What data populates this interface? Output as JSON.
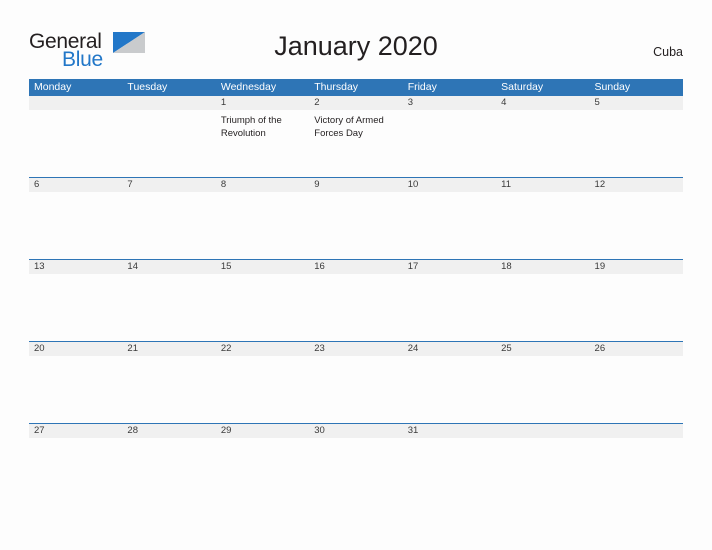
{
  "brand": {
    "name_part1": "General",
    "name_part2": "Blue",
    "flag_icon": "flag-triangle-icon",
    "color_primary": "#2277c8",
    "color_text": "#231f20"
  },
  "header": {
    "title": "January 2020",
    "country": "Cuba"
  },
  "calendar": {
    "header_bg": "#2e75b6",
    "date_band_bg": "#f0f0f0",
    "weekday_headers": [
      "Monday",
      "Tuesday",
      "Wednesday",
      "Thursday",
      "Friday",
      "Saturday",
      "Sunday"
    ],
    "weeks": [
      {
        "days": [
          {
            "date": "",
            "event": ""
          },
          {
            "date": "",
            "event": ""
          },
          {
            "date": "1",
            "event": "Triumph of the Revolution"
          },
          {
            "date": "2",
            "event": "Victory of Armed Forces Day"
          },
          {
            "date": "3",
            "event": ""
          },
          {
            "date": "4",
            "event": ""
          },
          {
            "date": "5",
            "event": ""
          }
        ]
      },
      {
        "days": [
          {
            "date": "6",
            "event": ""
          },
          {
            "date": "7",
            "event": ""
          },
          {
            "date": "8",
            "event": ""
          },
          {
            "date": "9",
            "event": ""
          },
          {
            "date": "10",
            "event": ""
          },
          {
            "date": "11",
            "event": ""
          },
          {
            "date": "12",
            "event": ""
          }
        ]
      },
      {
        "days": [
          {
            "date": "13",
            "event": ""
          },
          {
            "date": "14",
            "event": ""
          },
          {
            "date": "15",
            "event": ""
          },
          {
            "date": "16",
            "event": ""
          },
          {
            "date": "17",
            "event": ""
          },
          {
            "date": "18",
            "event": ""
          },
          {
            "date": "19",
            "event": ""
          }
        ]
      },
      {
        "days": [
          {
            "date": "20",
            "event": ""
          },
          {
            "date": "21",
            "event": ""
          },
          {
            "date": "22",
            "event": ""
          },
          {
            "date": "23",
            "event": ""
          },
          {
            "date": "24",
            "event": ""
          },
          {
            "date": "25",
            "event": ""
          },
          {
            "date": "26",
            "event": ""
          }
        ]
      },
      {
        "days": [
          {
            "date": "27",
            "event": ""
          },
          {
            "date": "28",
            "event": ""
          },
          {
            "date": "29",
            "event": ""
          },
          {
            "date": "30",
            "event": ""
          },
          {
            "date": "31",
            "event": ""
          },
          {
            "date": "",
            "event": ""
          },
          {
            "date": "",
            "event": ""
          }
        ]
      }
    ]
  }
}
